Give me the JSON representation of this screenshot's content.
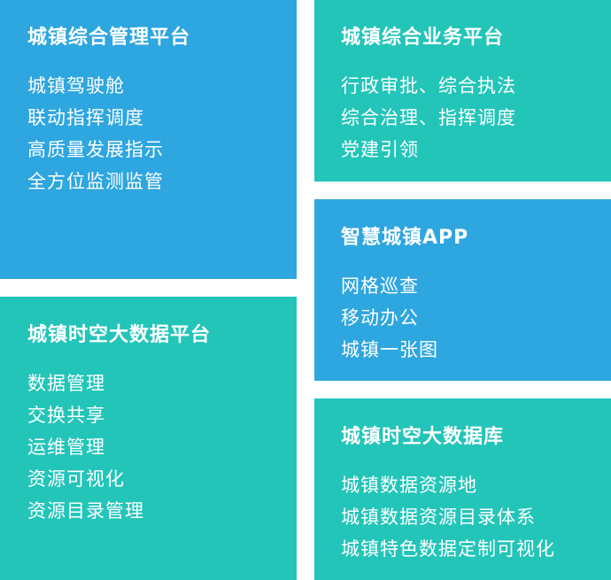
{
  "colors": {
    "blue_panel": "#2ea6e0",
    "teal_panel": "#23c5b9",
    "text": "#ffffff"
  },
  "panels": [
    {
      "title": "城镇综合管理平台",
      "items": [
        "城镇驾驶舱",
        "联动指挥调度",
        "高质量发展指示",
        "全方位监测监管"
      ]
    },
    {
      "title": "城镇时空大数据平台",
      "items": [
        "数据管理",
        "交换共享",
        "运维管理",
        "资源可视化",
        "资源目录管理"
      ]
    },
    {
      "title": "城镇综合业务平台",
      "items": [
        "行政审批、综合执法",
        "综合治理、指挥调度",
        "党建引领"
      ]
    },
    {
      "title": "智慧城镇APP",
      "items": [
        "网格巡查",
        "移动办公",
        "城镇一张图"
      ]
    },
    {
      "title": "城镇时空大数据库",
      "items": [
        "城镇数据资源地",
        "城镇数据资源目录体系",
        "城镇特色数据定制可视化"
      ]
    }
  ]
}
